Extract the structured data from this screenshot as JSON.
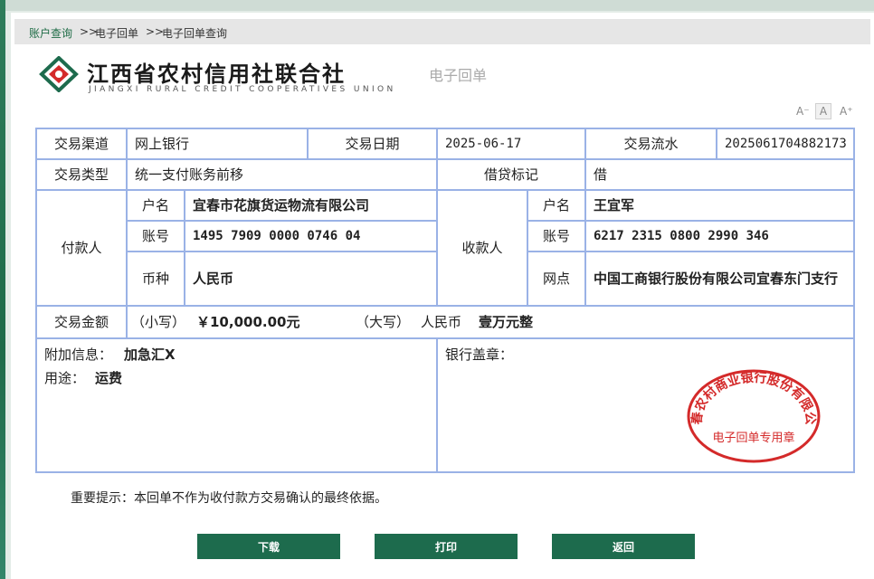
{
  "breadcrumb": {
    "items": [
      "账户查询",
      "电子回单",
      "电子回单查询"
    ],
    "separator": ">>"
  },
  "logo": {
    "cn": "江西省农村信用社联合社",
    "en": "JIANGXI RURAL CREDIT COOPERATIVES UNION"
  },
  "doc_title": "电子回单",
  "font_controls": {
    "decrease": "A⁻",
    "normal": "A",
    "increase": "A⁺"
  },
  "receipt": {
    "channel_label": "交易渠道",
    "channel": "网上银行",
    "date_label": "交易日期",
    "date": "2025-06-17",
    "serial_label": "交易流水",
    "serial": "2025061704882173",
    "type_label": "交易类型",
    "type": "统一支付账务前移",
    "dc_label": "借贷标记",
    "dc": "借",
    "payer_label": "付款人",
    "payer": {
      "name_label": "户名",
      "name": "宜春市花旗货运物流有限公司",
      "account_label": "账号",
      "account": "1495 7909 0000 0746 04",
      "currency_label": "币种",
      "currency": "人民币"
    },
    "payee_label": "收款人",
    "payee": {
      "name_label": "户名",
      "name": "王宜军",
      "account_label": "账号",
      "account": "6217 2315 0800 2990 346",
      "branch_label": "网点",
      "branch": "中国工商银行股份有限公司宜春东门支行"
    },
    "amount_label": "交易金额",
    "amount_small_label": "（小写）",
    "amount_small": "￥10,000.00元",
    "amount_big_label": "（大写）",
    "amount_big_prefix": "人民币",
    "amount_big": "壹万元整",
    "extra_label": "附加信息：",
    "extra": "加急汇X",
    "usage_label": "用途：",
    "usage": "运费",
    "seal_label": "银行盖章：",
    "stamp_text": "宜春农村商业银行股份有限公司",
    "stamp_sub": "电子回单专用章"
  },
  "notice": "重要提示：本回单不作为收付款方交易确认的最终依据。",
  "buttons": {
    "download": "下载",
    "print": "打印",
    "back": "返回"
  },
  "colors": {
    "brand": "#1d6b4d",
    "border": "#9ab2e6",
    "stamp": "#d42a2a"
  }
}
